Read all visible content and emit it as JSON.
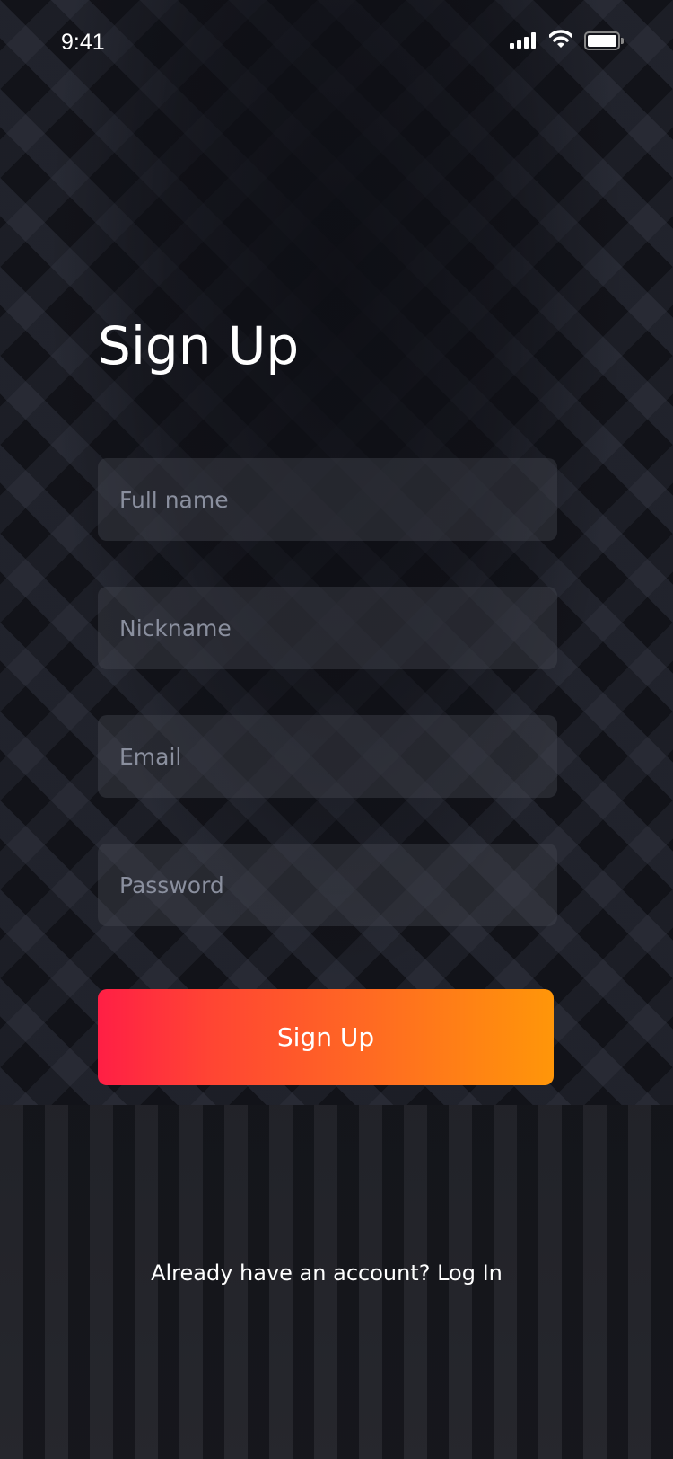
{
  "status_bar": {
    "time": "9:41",
    "icons": [
      "signal-icon",
      "wifi-icon",
      "battery-icon"
    ]
  },
  "title": "Sign Up",
  "fields": [
    {
      "placeholder": "Full name",
      "value": ""
    },
    {
      "placeholder": "Nickname",
      "value": ""
    },
    {
      "placeholder": "Email",
      "value": ""
    },
    {
      "placeholder": "Password",
      "value": ""
    }
  ],
  "submit_label": "Sign Up",
  "footer": {
    "prompt": "Already have an account?",
    "link": "Log In"
  },
  "colors": {
    "gradient_start": "#ff1f45",
    "gradient_end": "#ff9609",
    "background": "#0e0f15"
  }
}
